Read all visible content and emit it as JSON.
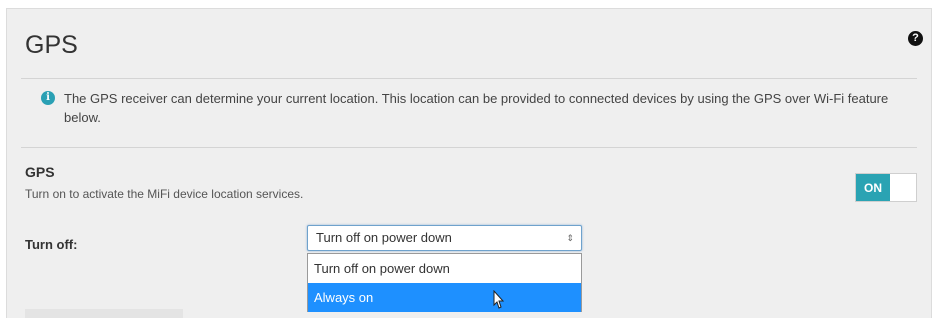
{
  "section": {
    "title": "GPS",
    "help_icon": "question-circle-icon"
  },
  "info": {
    "icon": "info-circle-icon",
    "text": "The GPS receiver can determine your current location. This location can be provided to connected devices by using the GPS over Wi-Fi feature below."
  },
  "gps_setting": {
    "label": "GPS",
    "description": "Turn on to activate the MiFi device location services.",
    "toggle_state": "ON",
    "toggle_color": "#2aa3b3"
  },
  "turn_off": {
    "label": "Turn off:",
    "selected_value": "Turn off on power down",
    "options": [
      {
        "label": "Turn off on power down",
        "highlighted": false
      },
      {
        "label": "Always on",
        "highlighted": true
      }
    ],
    "highlight_color": "#1e90ff"
  }
}
